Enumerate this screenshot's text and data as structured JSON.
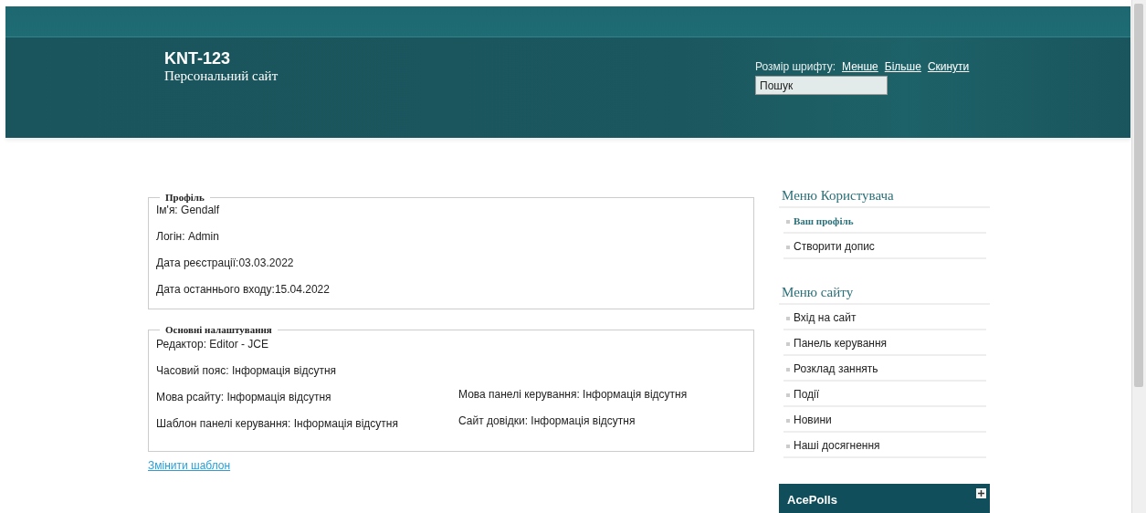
{
  "header": {
    "title": "KNT-123",
    "subtitle": "Персональний сайт",
    "font_size": {
      "label": "Розмір шрифту:",
      "links": [
        "Менше",
        "Більше",
        "Скинути"
      ]
    },
    "search": {
      "placeholder": "Пошук"
    }
  },
  "profile": {
    "legend": "Профіль",
    "lines": [
      "Ім'я: Gendalf",
      "Логін: Admin",
      "Дата реєстрації:03.03.2022",
      "Дата останнього входу:15.04.2022"
    ]
  },
  "settings": {
    "legend": "Основні налаштування",
    "left": [
      "Редактор: Editor - JCE",
      "Часовий пояс: Інформація відсутня",
      "Мова рсайту: Інформація відсутня",
      "Шаблон панелі керування: Інформація відсутня"
    ],
    "right": [
      "Мова панелі керування: Інформація відсутня",
      "Сайт довідки: Інформація відсутня"
    ]
  },
  "change_template_link": "Змінити шаблон",
  "sidebar": {
    "menus": [
      {
        "title": "Меню Користувача",
        "items": [
          {
            "label": "Ваш профіль",
            "selected": true
          },
          {
            "label": "Створити допис",
            "selected": false
          }
        ]
      },
      {
        "title": "Меню сайту",
        "items": [
          {
            "label": "Вхід на сайт",
            "selected": false
          },
          {
            "label": "Панель керування",
            "selected": false
          },
          {
            "label": "Розклад заннять",
            "selected": false
          },
          {
            "label": "Події",
            "selected": false
          },
          {
            "label": "Новини",
            "selected": false
          },
          {
            "label": "Наші досягнення",
            "selected": false
          }
        ]
      }
    ],
    "polls_title": "AcePolls"
  }
}
